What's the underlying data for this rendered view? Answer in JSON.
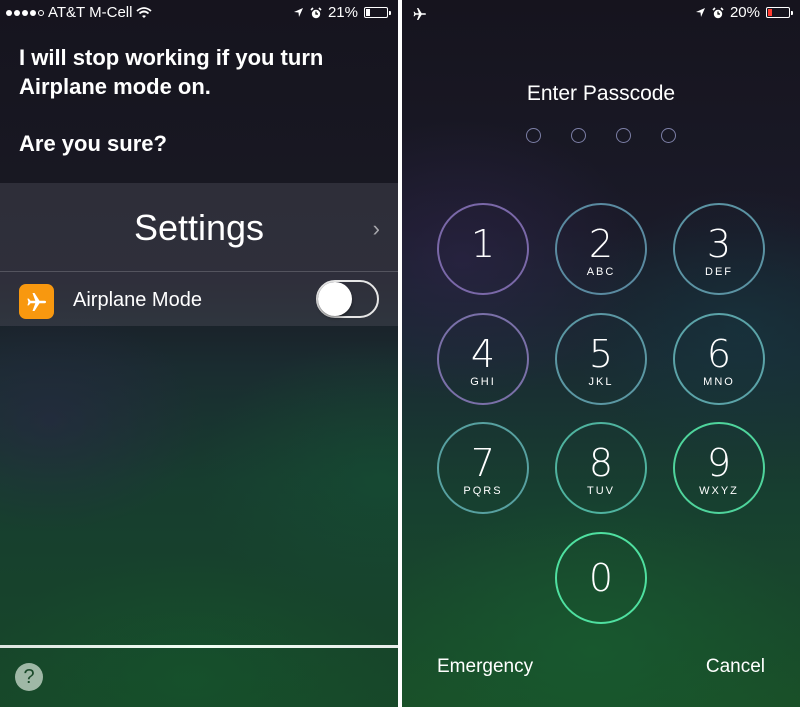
{
  "left_screen": {
    "status_bar": {
      "signal_bars_filled": 4,
      "signal_bars_total": 5,
      "carrier": "AT&T M-Cell",
      "wifi_icon": "wifi-icon",
      "location_icon": "location-arrow-icon",
      "alarm_icon": "alarm-clock-icon",
      "battery_percent_label": "21%",
      "battery_level": 0.21,
      "battery_color": "#ffffff"
    },
    "siri": {
      "message": "I will stop working if you turn Airplane mode on.",
      "question": "Are you sure?"
    },
    "settings_card": {
      "title": "Settings",
      "chevron": "›",
      "airplane_row": {
        "icon": "airplane-icon",
        "icon_color": "#f8980f",
        "label": "Airplane Mode",
        "toggle_on": false
      }
    },
    "help_button": "?"
  },
  "right_screen": {
    "status_bar": {
      "airplane_icon": "airplane-icon",
      "location_icon": "location-arrow-icon",
      "alarm_icon": "alarm-clock-icon",
      "battery_percent_label": "20%",
      "battery_level": 0.2,
      "battery_color": "#ff3b30"
    },
    "title": "Enter Passcode",
    "passcode_length": 4,
    "keys": [
      {
        "num": "1",
        "letters": ""
      },
      {
        "num": "2",
        "letters": "ABC"
      },
      {
        "num": "3",
        "letters": "DEF"
      },
      {
        "num": "4",
        "letters": "GHI"
      },
      {
        "num": "5",
        "letters": "JKL"
      },
      {
        "num": "6",
        "letters": "MNO"
      },
      {
        "num": "7",
        "letters": "PQRS"
      },
      {
        "num": "8",
        "letters": "TUV"
      },
      {
        "num": "9",
        "letters": "WXYZ"
      },
      {
        "num": "0",
        "letters": ""
      }
    ],
    "emergency_label": "Emergency",
    "cancel_label": "Cancel"
  }
}
